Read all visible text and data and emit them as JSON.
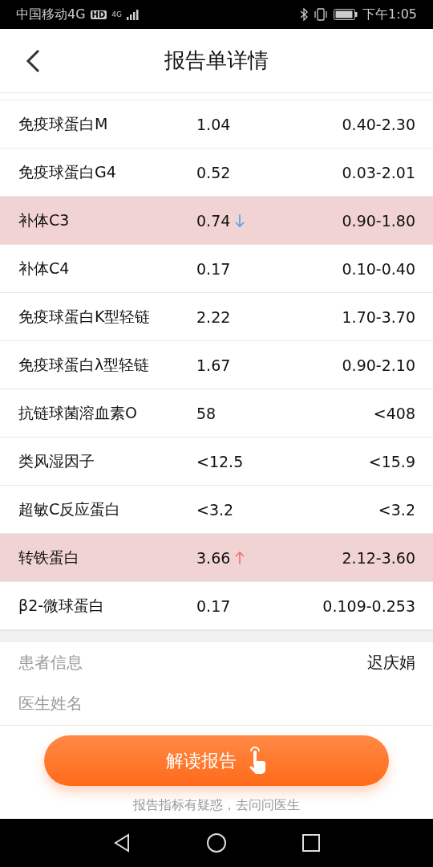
{
  "status_bar": {
    "carrier": "中国移动4G",
    "hd_badge": "HD",
    "network": "4G",
    "time": "下午1:05"
  },
  "header": {
    "title": "报告单详情"
  },
  "results": [
    {
      "name": "免疫球蛋白M",
      "value": "1.04",
      "kind": "normal",
      "range": "0.40-2.30"
    },
    {
      "name": "免疫球蛋白G4",
      "value": "0.52",
      "kind": "normal",
      "range": "0.03-2.01"
    },
    {
      "name": "补体C3",
      "value": "0.74",
      "kind": "low",
      "range": "0.90-1.80"
    },
    {
      "name": "补体C4",
      "value": "0.17",
      "kind": "normal",
      "range": "0.10-0.40"
    },
    {
      "name": "免疫球蛋白K型轻链",
      "value": "2.22",
      "kind": "normal",
      "range": "1.70-3.70"
    },
    {
      "name": "免疫球蛋白λ型轻链",
      "value": "1.67",
      "kind": "normal",
      "range": "0.90-2.10"
    },
    {
      "name": "抗链球菌溶血素O",
      "value": "58",
      "kind": "normal",
      "range": "<408"
    },
    {
      "name": "类风湿因子",
      "value": "<12.5",
      "kind": "normal",
      "range": "<15.9"
    },
    {
      "name": "超敏C反应蛋白",
      "value": "<3.2",
      "kind": "normal",
      "range": "<3.2"
    },
    {
      "name": "转铁蛋白",
      "value": "3.66",
      "kind": "high",
      "range": "2.12-3.60"
    },
    {
      "name": "β2-微球蛋白",
      "value": "0.17",
      "kind": "normal",
      "range": "0.109-0.253"
    }
  ],
  "info": [
    {
      "label": "患者信息",
      "value": "迟庆娟"
    },
    {
      "label": "医生姓名"
    }
  ],
  "action": {
    "button": "解读报告",
    "hint": "报告指标有疑惑，去问问医生"
  }
}
